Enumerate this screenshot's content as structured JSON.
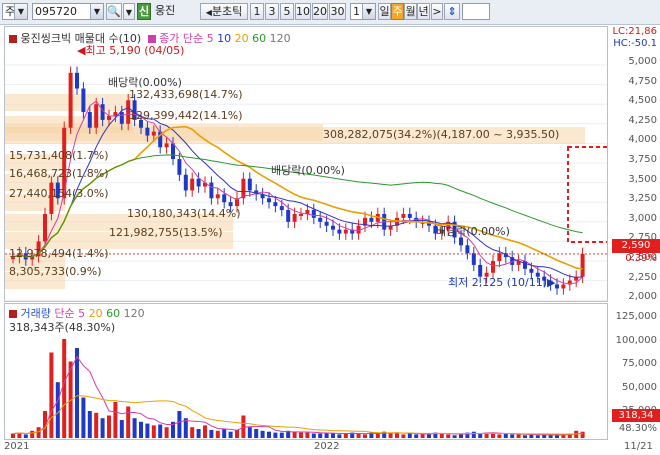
{
  "toolbar": {
    "market": "주",
    "code": "095720",
    "stock_name": "웅진",
    "credit_badge": "신",
    "period_label": "분초틱",
    "periods": [
      "1",
      "3",
      "5",
      "10",
      "20",
      "30"
    ],
    "interval_value": "1",
    "views": [
      "일",
      "주",
      "월",
      "년"
    ],
    "active_view": "주",
    "nav_next": ">",
    "updown_icon": "⇕"
  },
  "price_pane": {
    "legend": {
      "name": "웅진씽크빅 매물대 수(10)",
      "ma_label": "종가 단순",
      "ma_periods": [
        "5",
        "10",
        "20",
        "60",
        "120"
      ],
      "ma_colors": [
        "#d23ea8",
        "#3030c8",
        "#e8a000",
        "#2a9a2a",
        "#777777"
      ]
    },
    "high_label": "최고 5,190 (04/05)",
    "low_label": "최저 2,125 (10/11)",
    "dividend_labels": [
      "배당락(0.00%)",
      "배당락(0.00%)",
      "배당락(0.00%)"
    ],
    "volume_profile": [
      "132,433,698(14.7%)",
      "129,399,442(14.1%)",
      "308,282,075(34.2%)(4,187.00 ~ 3,935.50)",
      "15,731,408(1.7%)",
      "16,468,723(1.8%)",
      "27,440,154(3.0%)",
      "130,180,343(14.4%)",
      "121,982,755(13.5%)",
      "12,978,494(1.4%)",
      "8,305,733(0.9%)"
    ],
    "lc_label": "LC:21,86",
    "hc_label": "HC:-50.1",
    "y_ticks": [
      "5,000",
      "4,750",
      "4,500",
      "4,250",
      "4,000",
      "3,750",
      "3,500",
      "3,250",
      "3,000",
      "2,750",
      "2,500",
      "2,250",
      "2,000"
    ],
    "current_price": "2,590",
    "current_change": "0.39%"
  },
  "volume_pane": {
    "legend": {
      "name": "거래량",
      "ma_label": "단순",
      "ma_periods": [
        "5",
        "20",
        "60",
        "120"
      ]
    },
    "top_label": "318,343주(48.30%)",
    "y_ticks": [
      "125,000",
      "100,000",
      "75,000",
      "50,000",
      "25,000"
    ],
    "current_volume": "318,34",
    "current_pct": "48.30%"
  },
  "x_axis": {
    "labels": [
      "2021",
      "2022"
    ],
    "right_label": "11/21"
  },
  "colors": {
    "up": "#e0201e",
    "down": "#1f38c8",
    "profile": "#f5d6aa",
    "selection": "#e0201e"
  }
}
